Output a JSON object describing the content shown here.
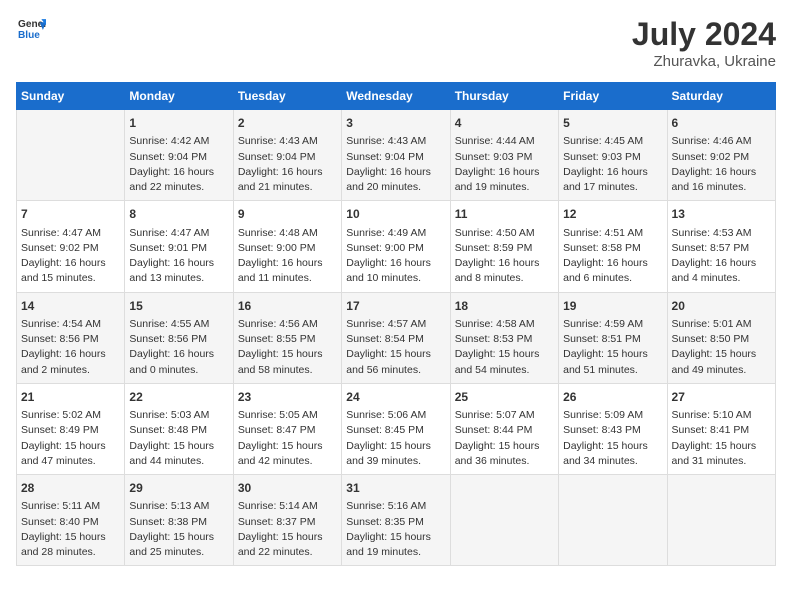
{
  "header": {
    "logo_line1": "General",
    "logo_line2": "Blue",
    "month": "July 2024",
    "location": "Zhuravka, Ukraine"
  },
  "columns": [
    "Sunday",
    "Monday",
    "Tuesday",
    "Wednesday",
    "Thursday",
    "Friday",
    "Saturday"
  ],
  "weeks": [
    [
      {
        "day": "",
        "lines": []
      },
      {
        "day": "1",
        "lines": [
          "Sunrise: 4:42 AM",
          "Sunset: 9:04 PM",
          "Daylight: 16 hours",
          "and 22 minutes."
        ]
      },
      {
        "day": "2",
        "lines": [
          "Sunrise: 4:43 AM",
          "Sunset: 9:04 PM",
          "Daylight: 16 hours",
          "and 21 minutes."
        ]
      },
      {
        "day": "3",
        "lines": [
          "Sunrise: 4:43 AM",
          "Sunset: 9:04 PM",
          "Daylight: 16 hours",
          "and 20 minutes."
        ]
      },
      {
        "day": "4",
        "lines": [
          "Sunrise: 4:44 AM",
          "Sunset: 9:03 PM",
          "Daylight: 16 hours",
          "and 19 minutes."
        ]
      },
      {
        "day": "5",
        "lines": [
          "Sunrise: 4:45 AM",
          "Sunset: 9:03 PM",
          "Daylight: 16 hours",
          "and 17 minutes."
        ]
      },
      {
        "day": "6",
        "lines": [
          "Sunrise: 4:46 AM",
          "Sunset: 9:02 PM",
          "Daylight: 16 hours",
          "and 16 minutes."
        ]
      }
    ],
    [
      {
        "day": "7",
        "lines": [
          "Sunrise: 4:47 AM",
          "Sunset: 9:02 PM",
          "Daylight: 16 hours",
          "and 15 minutes."
        ]
      },
      {
        "day": "8",
        "lines": [
          "Sunrise: 4:47 AM",
          "Sunset: 9:01 PM",
          "Daylight: 16 hours",
          "and 13 minutes."
        ]
      },
      {
        "day": "9",
        "lines": [
          "Sunrise: 4:48 AM",
          "Sunset: 9:00 PM",
          "Daylight: 16 hours",
          "and 11 minutes."
        ]
      },
      {
        "day": "10",
        "lines": [
          "Sunrise: 4:49 AM",
          "Sunset: 9:00 PM",
          "Daylight: 16 hours",
          "and 10 minutes."
        ]
      },
      {
        "day": "11",
        "lines": [
          "Sunrise: 4:50 AM",
          "Sunset: 8:59 PM",
          "Daylight: 16 hours",
          "and 8 minutes."
        ]
      },
      {
        "day": "12",
        "lines": [
          "Sunrise: 4:51 AM",
          "Sunset: 8:58 PM",
          "Daylight: 16 hours",
          "and 6 minutes."
        ]
      },
      {
        "day": "13",
        "lines": [
          "Sunrise: 4:53 AM",
          "Sunset: 8:57 PM",
          "Daylight: 16 hours",
          "and 4 minutes."
        ]
      }
    ],
    [
      {
        "day": "14",
        "lines": [
          "Sunrise: 4:54 AM",
          "Sunset: 8:56 PM",
          "Daylight: 16 hours",
          "and 2 minutes."
        ]
      },
      {
        "day": "15",
        "lines": [
          "Sunrise: 4:55 AM",
          "Sunset: 8:56 PM",
          "Daylight: 16 hours",
          "and 0 minutes."
        ]
      },
      {
        "day": "16",
        "lines": [
          "Sunrise: 4:56 AM",
          "Sunset: 8:55 PM",
          "Daylight: 15 hours",
          "and 58 minutes."
        ]
      },
      {
        "day": "17",
        "lines": [
          "Sunrise: 4:57 AM",
          "Sunset: 8:54 PM",
          "Daylight: 15 hours",
          "and 56 minutes."
        ]
      },
      {
        "day": "18",
        "lines": [
          "Sunrise: 4:58 AM",
          "Sunset: 8:53 PM",
          "Daylight: 15 hours",
          "and 54 minutes."
        ]
      },
      {
        "day": "19",
        "lines": [
          "Sunrise: 4:59 AM",
          "Sunset: 8:51 PM",
          "Daylight: 15 hours",
          "and 51 minutes."
        ]
      },
      {
        "day": "20",
        "lines": [
          "Sunrise: 5:01 AM",
          "Sunset: 8:50 PM",
          "Daylight: 15 hours",
          "and 49 minutes."
        ]
      }
    ],
    [
      {
        "day": "21",
        "lines": [
          "Sunrise: 5:02 AM",
          "Sunset: 8:49 PM",
          "Daylight: 15 hours",
          "and 47 minutes."
        ]
      },
      {
        "day": "22",
        "lines": [
          "Sunrise: 5:03 AM",
          "Sunset: 8:48 PM",
          "Daylight: 15 hours",
          "and 44 minutes."
        ]
      },
      {
        "day": "23",
        "lines": [
          "Sunrise: 5:05 AM",
          "Sunset: 8:47 PM",
          "Daylight: 15 hours",
          "and 42 minutes."
        ]
      },
      {
        "day": "24",
        "lines": [
          "Sunrise: 5:06 AM",
          "Sunset: 8:45 PM",
          "Daylight: 15 hours",
          "and 39 minutes."
        ]
      },
      {
        "day": "25",
        "lines": [
          "Sunrise: 5:07 AM",
          "Sunset: 8:44 PM",
          "Daylight: 15 hours",
          "and 36 minutes."
        ]
      },
      {
        "day": "26",
        "lines": [
          "Sunrise: 5:09 AM",
          "Sunset: 8:43 PM",
          "Daylight: 15 hours",
          "and 34 minutes."
        ]
      },
      {
        "day": "27",
        "lines": [
          "Sunrise: 5:10 AM",
          "Sunset: 8:41 PM",
          "Daylight: 15 hours",
          "and 31 minutes."
        ]
      }
    ],
    [
      {
        "day": "28",
        "lines": [
          "Sunrise: 5:11 AM",
          "Sunset: 8:40 PM",
          "Daylight: 15 hours",
          "and 28 minutes."
        ]
      },
      {
        "day": "29",
        "lines": [
          "Sunrise: 5:13 AM",
          "Sunset: 8:38 PM",
          "Daylight: 15 hours",
          "and 25 minutes."
        ]
      },
      {
        "day": "30",
        "lines": [
          "Sunrise: 5:14 AM",
          "Sunset: 8:37 PM",
          "Daylight: 15 hours",
          "and 22 minutes."
        ]
      },
      {
        "day": "31",
        "lines": [
          "Sunrise: 5:16 AM",
          "Sunset: 8:35 PM",
          "Daylight: 15 hours",
          "and 19 minutes."
        ]
      },
      {
        "day": "",
        "lines": []
      },
      {
        "day": "",
        "lines": []
      },
      {
        "day": "",
        "lines": []
      }
    ]
  ]
}
